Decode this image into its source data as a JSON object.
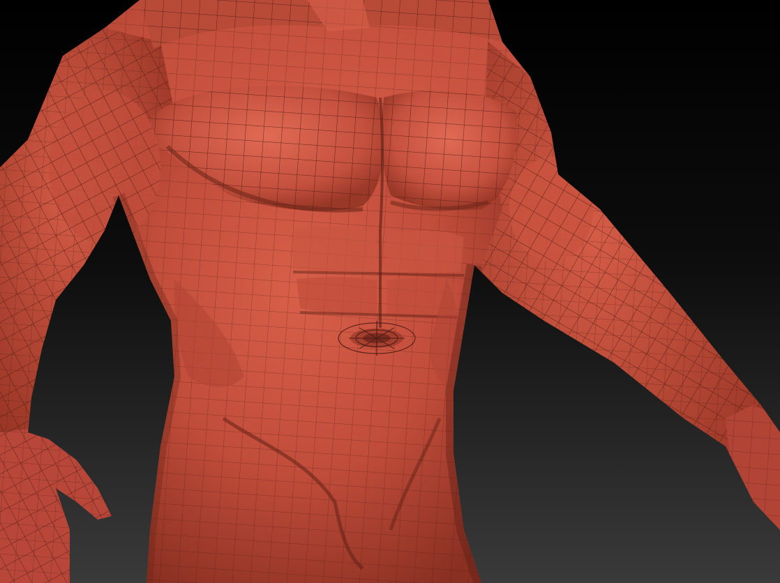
{
  "scene": {
    "subject": "wireframe-mesh-muscular-torso",
    "background_top_color": "#000000",
    "background_bottom_color": "#3a3a3a",
    "mesh_base_color": "#c4503e",
    "mesh_highlight_color": "#e0705c",
    "mesh_shadow_color": "#7a2a1e",
    "wire_color": "#4a1a12"
  }
}
